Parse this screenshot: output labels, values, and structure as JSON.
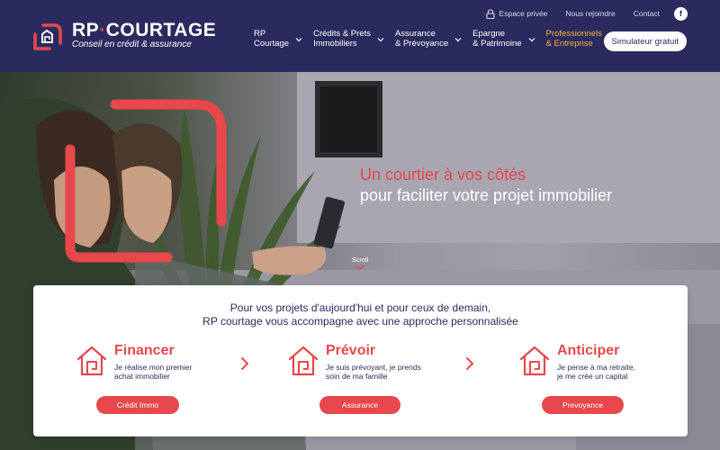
{
  "brand": {
    "name_part1": "RP",
    "name_part2": "COURTAGE",
    "tagline": "Conseil en crédit & assurance"
  },
  "topbar": {
    "espace_privee": "Espace privée",
    "nous_rejoindre": "Nous rejoindre",
    "contact": "Contact",
    "facebook_glyph": "f"
  },
  "nav": {
    "items": [
      {
        "label": "RP\nCourtage"
      },
      {
        "label": "Crédits & Prets\nImmobiliers"
      },
      {
        "label": "Assurance\n& Prévoyance"
      },
      {
        "label": "Epargne\n& Patrimoine"
      },
      {
        "label": "Professionnels\n& Entreprise"
      }
    ],
    "simulator_label": "Simulateur gratuit"
  },
  "hero": {
    "headline_line1": "Un courtier à vos côtés",
    "headline_line2": "pour faciliter votre projet immobilier",
    "scroll_label": "Scroll"
  },
  "intro": {
    "line1": "Pour vos projets d'aujourd'hui et pour ceux de demain,",
    "line2": "RP courtage vous accompagne avec une approche personnalisée"
  },
  "services": [
    {
      "title": "Financer",
      "description": "Je réalise mon premier\nachat immobilier",
      "button": "Crédit Immo"
    },
    {
      "title": "Prévoir",
      "description": "Je suis prévoyant, je prends\nsoin de ma famille",
      "button": "Assurance"
    },
    {
      "title": "Anticiper",
      "description": "Je pense à ma retraite,\nje me crée un capital",
      "button": "Prevoyance"
    }
  ],
  "icons": {
    "logo": "rp-logo-icon",
    "lock": "lock-icon",
    "facebook": "facebook-icon",
    "chevron": "chevron-down-icon",
    "house": "house-icon",
    "arrow": "chevron-right-icon"
  },
  "colors": {
    "navy": "#2b2a5e",
    "red": "#e8474c",
    "gold": "#f2b53a",
    "white": "#ffffff"
  }
}
